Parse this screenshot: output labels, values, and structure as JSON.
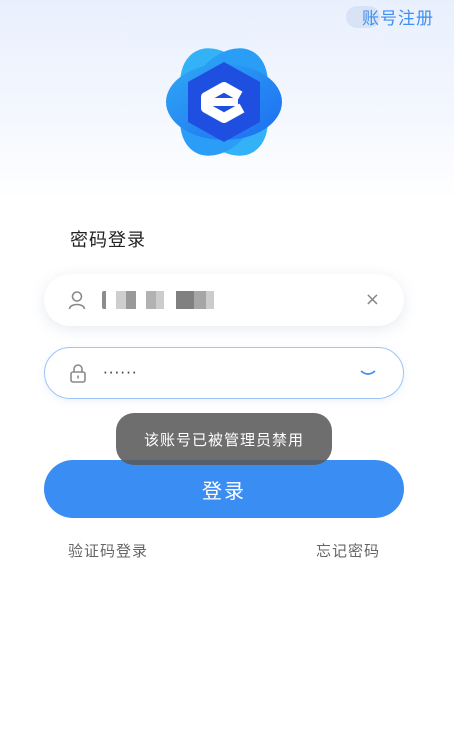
{
  "header": {
    "register_label": "账号注册"
  },
  "section_title": "密码登录",
  "username_field": {
    "value": "",
    "masked": true
  },
  "password_field": {
    "value": "······"
  },
  "toast": {
    "message": "该账号已被管理员禁用"
  },
  "login_button": {
    "label": "登录"
  },
  "links": {
    "sms_login": "验证码登录",
    "forgot_password": "忘记密码"
  },
  "colors": {
    "primary": "#3a8ef3",
    "link": "#3f8ef2",
    "logo_dark": "#1f4fe0",
    "logo_light": "#2fa8f5"
  },
  "icons": [
    "logo",
    "user-icon",
    "lock-icon",
    "clear-icon",
    "eye-closed-icon"
  ]
}
